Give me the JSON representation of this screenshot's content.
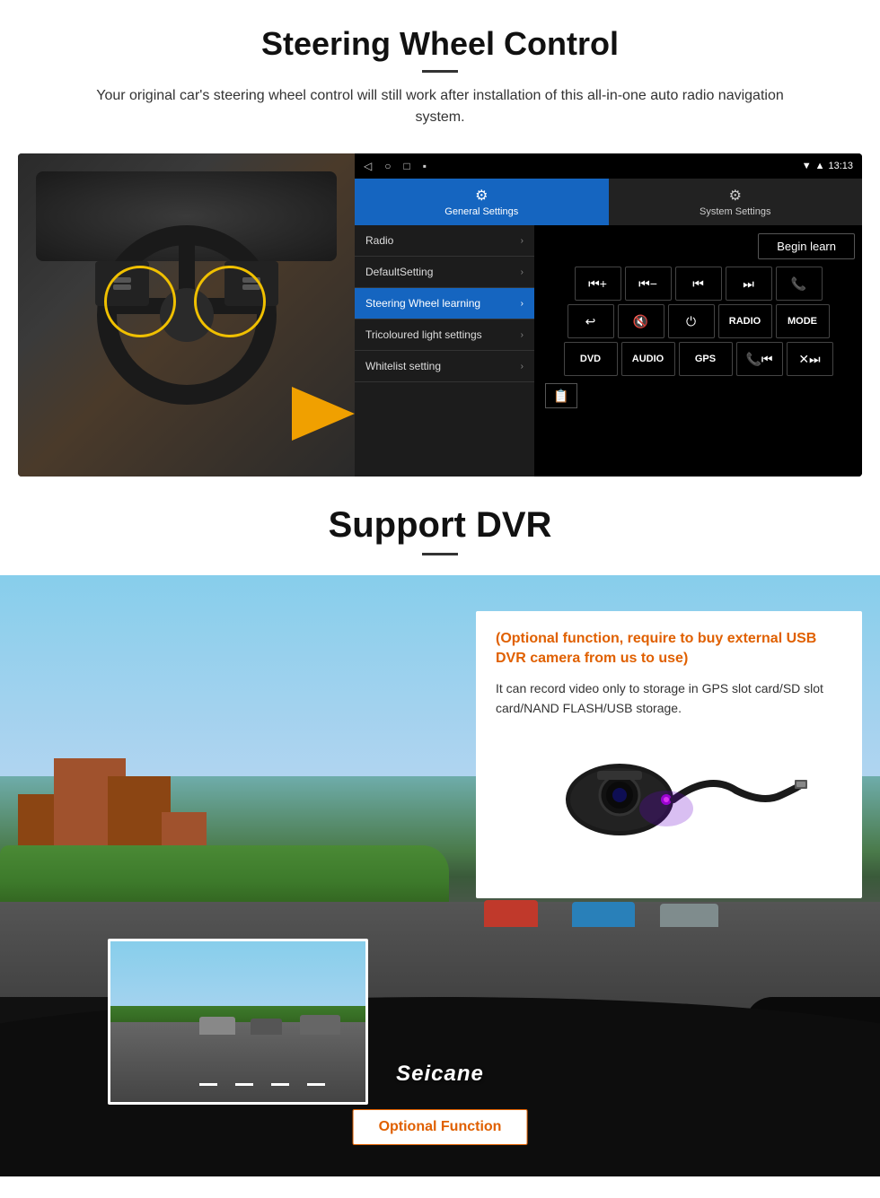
{
  "section1": {
    "title": "Steering Wheel Control",
    "subtitle": "Your original car's steering wheel control will still work after installation of this all-in-one auto radio navigation system.",
    "android_panel": {
      "topbar": {
        "nav_back": "◁",
        "nav_home": "○",
        "nav_square": "□",
        "nav_menu": "▪",
        "time": "13:13",
        "signal_icon": "signal"
      },
      "tabs": [
        {
          "label": "General Settings",
          "active": true,
          "icon": "⚙"
        },
        {
          "label": "System Settings",
          "active": false,
          "icon": "⚙"
        }
      ],
      "menu_items": [
        {
          "label": "Radio",
          "active": false
        },
        {
          "label": "DefaultSetting",
          "active": false
        },
        {
          "label": "Steering Wheel learning",
          "active": true
        },
        {
          "label": "Tricoloured light settings",
          "active": false
        },
        {
          "label": "Whitelist setting",
          "active": false
        }
      ],
      "begin_learn_label": "Begin learn",
      "control_buttons": [
        [
          "⏮+",
          "⏮-",
          "⏮",
          "⏭",
          "📞"
        ],
        [
          "↩",
          "🔇×",
          "⏻",
          "RADIO",
          "MODE"
        ],
        [
          "DVD",
          "AUDIO",
          "GPS",
          "📞⏮",
          "✕⏭"
        ]
      ],
      "whitelist_icon": "📋"
    }
  },
  "section2": {
    "title": "Support DVR",
    "info_box": {
      "optional_text": "(Optional function, require to buy external USB DVR camera from us to use)",
      "description": "It can record video only to storage in GPS slot card/SD slot card/NAND FLASH/USB storage."
    },
    "optional_function_label": "Optional Function",
    "brand_label": "Seicane"
  }
}
